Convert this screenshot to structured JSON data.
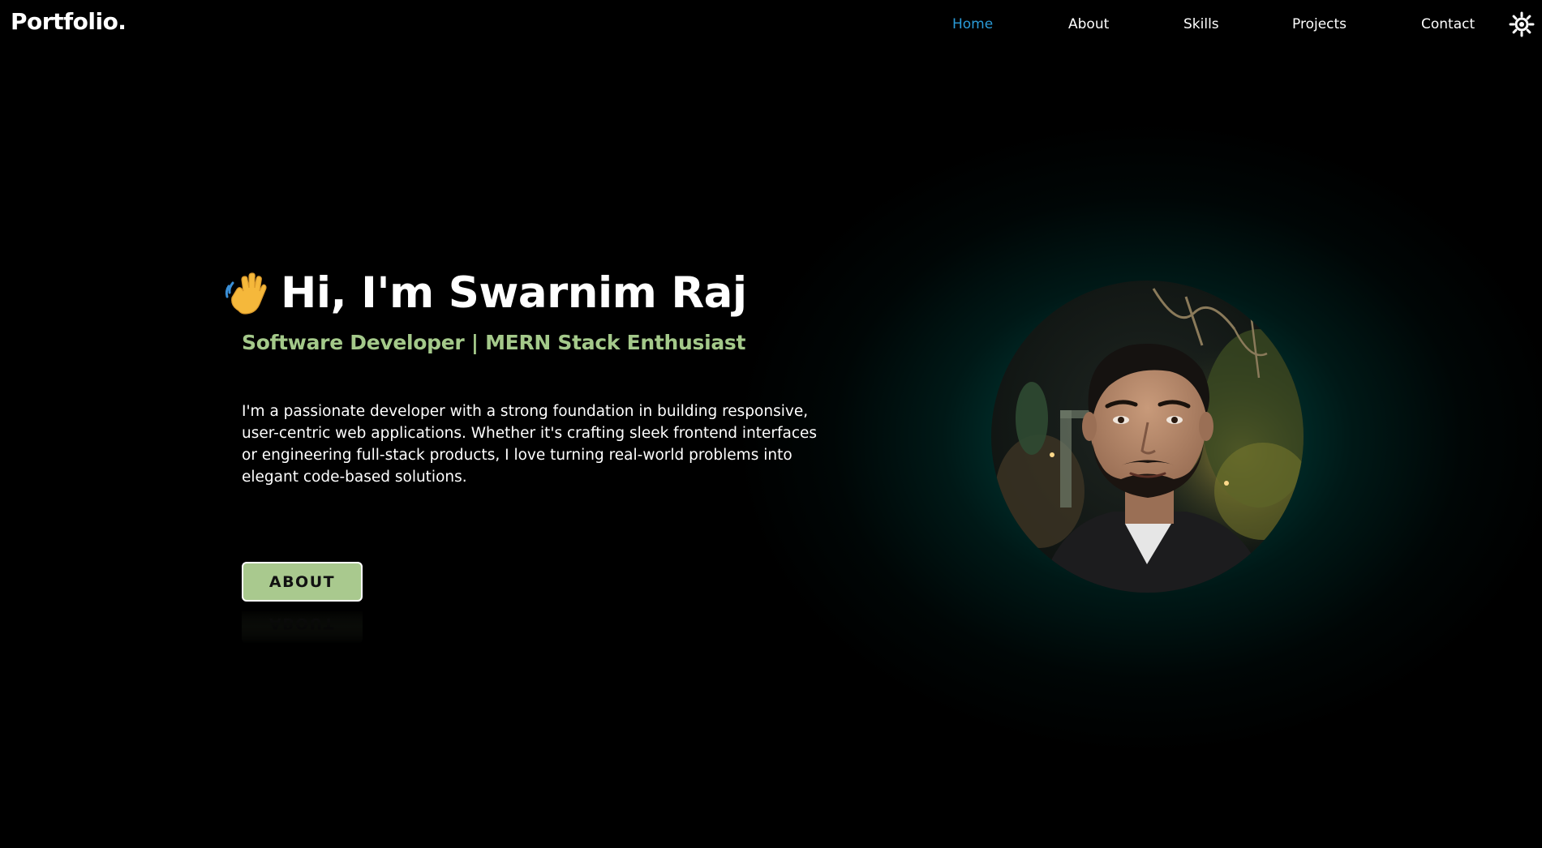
{
  "header": {
    "brand": "Portfolio.",
    "nav": {
      "home": "Home",
      "about": "About",
      "skills": "Skills",
      "projects": "Projects",
      "contact": "Contact"
    },
    "active_nav": "Home",
    "theme_toggle_icon": "sun-icon"
  },
  "hero": {
    "wave_icon": "👋",
    "title": "Hi, I'm Swarnim Raj",
    "subtitle": "Software Developer | MERN Stack Enthusiast",
    "bio": "I'm a passionate developer with a strong foundation in building responsive, user-centric web applications. Whether it's crafting sleek frontend interfaces or engineering full-stack products, I love turning real-world problems into elegant code-based solutions.",
    "about_button": "ABOUT"
  },
  "colors": {
    "background": "#000000",
    "accent_green": "#a4c98a",
    "active_link": "#2a9bd8",
    "glow": "#006e64"
  }
}
